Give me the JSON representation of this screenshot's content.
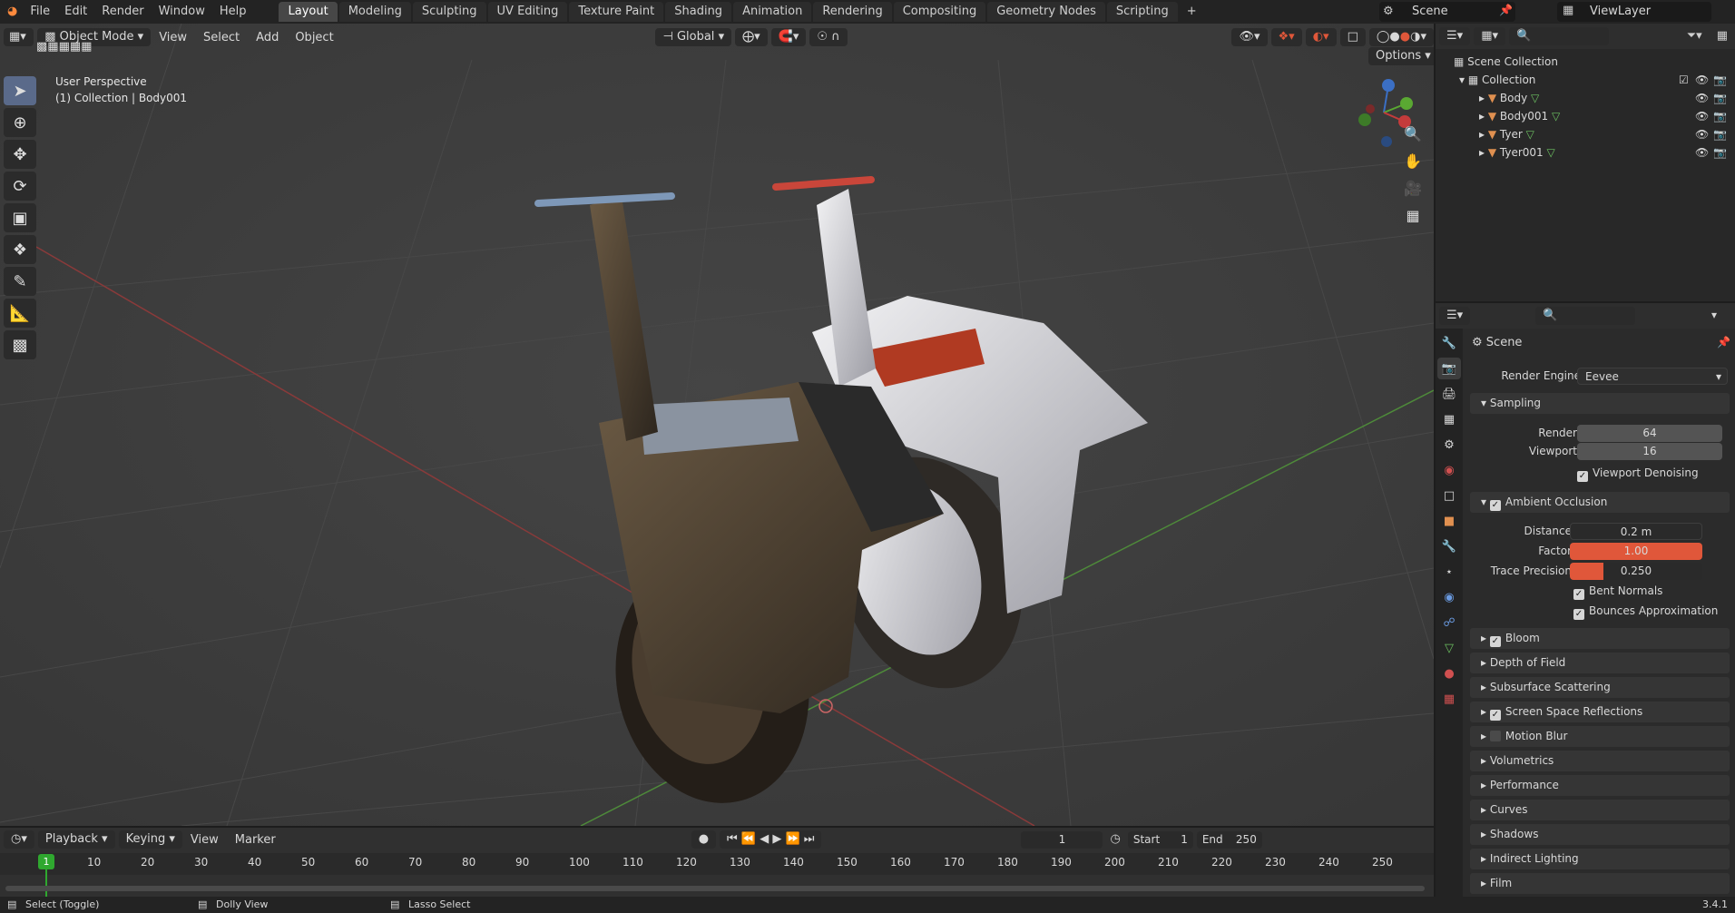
{
  "menubar": {
    "items": [
      "File",
      "Edit",
      "Render",
      "Window",
      "Help"
    ]
  },
  "workspaces": [
    "Layout",
    "Modeling",
    "Sculpting",
    "UV Editing",
    "Texture Paint",
    "Shading",
    "Animation",
    "Rendering",
    "Compositing",
    "Geometry Nodes",
    "Scripting"
  ],
  "active_workspace": "Layout",
  "scene_name": "Scene",
  "view_layer": "ViewLayer",
  "viewport": {
    "mode": "Object Mode",
    "menus": [
      "View",
      "Select",
      "Add",
      "Object"
    ],
    "transform_orientation": "Global",
    "options_label": "Options",
    "overlay_title": "User Perspective",
    "overlay_sub": "(1) Collection | Body001"
  },
  "outliner": {
    "root": "Scene Collection",
    "collection": "Collection",
    "objects": [
      "Body",
      "Body001",
      "Tyer",
      "Tyer001"
    ]
  },
  "properties": {
    "header": "Scene",
    "render_engine_label": "Render Engine",
    "render_engine": "Eevee",
    "sampling": {
      "title": "Sampling",
      "render_label": "Render",
      "render": "64",
      "viewport_label": "Viewport",
      "viewport": "16",
      "denoise": "Viewport Denoising"
    },
    "ao": {
      "title": "Ambient Occlusion",
      "distance_label": "Distance",
      "distance": "0.2 m",
      "factor_label": "Factor",
      "factor": "1.00",
      "factor_fraction": 1.0,
      "trace_label": "Trace Precision",
      "trace": "0.250",
      "trace_fraction": 0.25,
      "bent": "Bent Normals",
      "bounces": "Bounces Approximation"
    },
    "panels": [
      {
        "label": "Bloom",
        "checkbox": true,
        "checked": true
      },
      {
        "label": "Depth of Field",
        "checkbox": false
      },
      {
        "label": "Subsurface Scattering",
        "checkbox": false
      },
      {
        "label": "Screen Space Reflections",
        "checkbox": true,
        "checked": true
      },
      {
        "label": "Motion Blur",
        "checkbox": true,
        "checked": false
      },
      {
        "label": "Volumetrics",
        "checkbox": false
      },
      {
        "label": "Performance",
        "checkbox": false
      },
      {
        "label": "Curves",
        "checkbox": false
      },
      {
        "label": "Shadows",
        "checkbox": false
      },
      {
        "label": "Indirect Lighting",
        "checkbox": false
      },
      {
        "label": "Film",
        "checkbox": false
      }
    ]
  },
  "timeline": {
    "menus": [
      "Playback",
      "Keying",
      "View",
      "Marker"
    ],
    "current_frame": "1",
    "start_label": "Start",
    "start": "1",
    "end_label": "End",
    "end": "250",
    "ticks": [
      "10",
      "20",
      "30",
      "40",
      "50",
      "60",
      "70",
      "80",
      "90",
      "100",
      "110",
      "120",
      "130",
      "140",
      "150",
      "160",
      "170",
      "180",
      "190",
      "200",
      "210",
      "220",
      "230",
      "240",
      "250"
    ],
    "playhead": "1"
  },
  "statusbar": {
    "select": "Select (Toggle)",
    "dolly": "Dolly View",
    "lasso": "Lasso Select",
    "version": "3.4.1"
  },
  "colors": {
    "accent": "#e0573a",
    "selected_tab": "#474747",
    "tool_active": "#5a6a8a",
    "playhead": "#2fa82f"
  }
}
